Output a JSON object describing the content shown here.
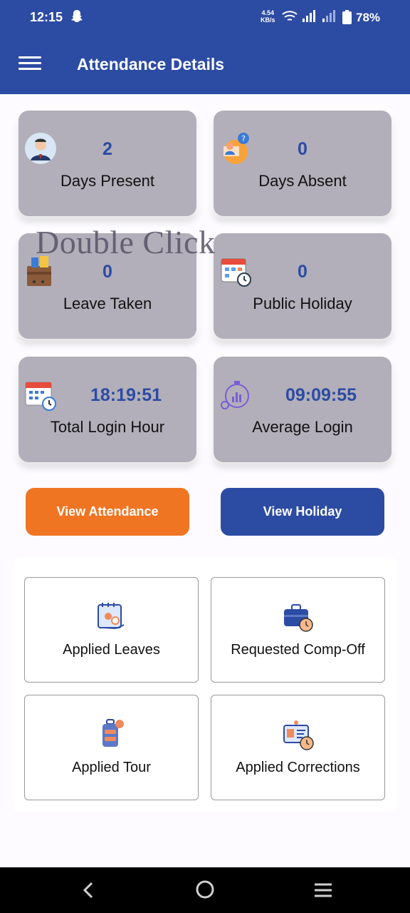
{
  "status_bar": {
    "time": "12:15",
    "net_speed_value": "4.54",
    "net_speed_unit": "KB/s",
    "battery": "78%"
  },
  "app_bar": {
    "title": "Attendance Details"
  },
  "stats": {
    "days_present": {
      "value": "2",
      "label": "Days Present"
    },
    "days_absent": {
      "value": "0",
      "label": "Days Absent"
    },
    "leave_taken": {
      "value": "0",
      "label": "Leave Taken"
    },
    "public_holiday": {
      "value": "0",
      "label": "Public Holiday"
    },
    "total_login_hour": {
      "value": "18:19:51",
      "label": "Total Login Hour"
    },
    "average_login": {
      "value": "09:09:55",
      "label": "Average Login"
    }
  },
  "overlay_text": "Double Click",
  "buttons": {
    "view_attendance": "View Attendance",
    "view_holiday": "View Holiday"
  },
  "tiles": {
    "applied_leaves": "Applied Leaves",
    "requested_comp_off": "Requested Comp-Off",
    "applied_tour": "Applied Tour",
    "applied_corrections": "Applied Corrections"
  },
  "colors": {
    "primary": "#2c4ba3",
    "accent": "#f07523",
    "card_bg": "#b2afba"
  }
}
